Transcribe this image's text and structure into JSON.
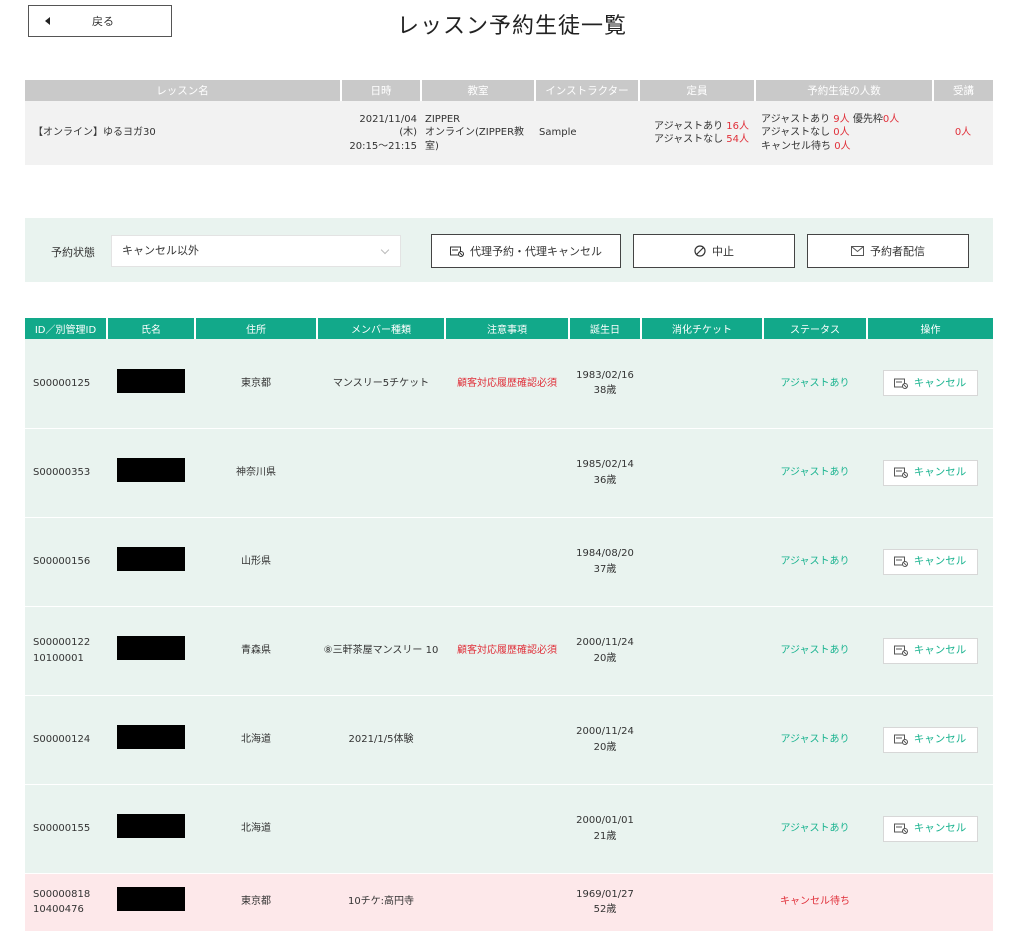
{
  "header": {
    "back_label": "戻る",
    "title": "レッスン予約生徒一覧"
  },
  "lesson": {
    "columns": [
      "レッスン名",
      "日時",
      "教室",
      "インストラクター",
      "定員",
      "予約生徒の人数",
      "受講"
    ],
    "name": "【オンライン】ゆるヨガ30",
    "date_line1": "2021/11/04 (木)",
    "date_line2": "20:15～21:15",
    "room_line1": "ZIPPER",
    "room_line2": "オンライン(ZIPPER教",
    "room_line3": "室)",
    "instructor": "Sample",
    "capacity": {
      "adjust_label": "アジャストあり",
      "adjust_value": "16人",
      "noadjust_label": "アジャストなし",
      "noadjust_value": "54人"
    },
    "reserved": {
      "adjust_label": "アジャストあり",
      "adjust_value": "9人",
      "priority_label": "優先枠",
      "priority_value": "0人",
      "noadjust_label": "アジャストなし",
      "noadjust_value": "0人",
      "wait_label": "キャンセル待ち",
      "wait_value": "0人"
    },
    "attended": "0人"
  },
  "filter": {
    "label": "予約状態",
    "selected": "キャンセル以外",
    "proxy_button": "代理予約・代理キャンセル",
    "stop_button": "中止",
    "mail_button": "予約者配信"
  },
  "table": {
    "columns": [
      "ID／別管理ID",
      "氏名",
      "住所",
      "メンバー種類",
      "注意事項",
      "誕生日",
      "消化チケット",
      "ステータス",
      "操作"
    ],
    "cancel_label": "キャンセル",
    "rows": [
      {
        "id": "S00000125",
        "sub_id": "",
        "address": "東京都",
        "member": "マンスリー5チケット",
        "note": "顧客対応履歴確認必須",
        "birth": "1983/02/16",
        "age": "38歳",
        "ticket": "",
        "status": "アジャストあり"
      },
      {
        "id": "S00000353",
        "sub_id": "",
        "address": "神奈川県",
        "member": "",
        "note": "",
        "birth": "1985/02/14",
        "age": "36歳",
        "ticket": "",
        "status": "アジャストあり"
      },
      {
        "id": "S00000156",
        "sub_id": "",
        "address": "山形県",
        "member": "",
        "note": "",
        "birth": "1984/08/20",
        "age": "37歳",
        "ticket": "",
        "status": "アジャストあり"
      },
      {
        "id": "S00000122",
        "sub_id": "10100001",
        "address": "青森県",
        "member": "⑧三軒茶屋マンスリー 10",
        "note": "顧客対応履歴確認必須",
        "birth": "2000/11/24",
        "age": "20歳",
        "ticket": "",
        "status": "アジャストあり"
      },
      {
        "id": "S00000124",
        "sub_id": "",
        "address": "北海道",
        "member": "2021/1/5体験",
        "note": "",
        "birth": "2000/11/24",
        "age": "20歳",
        "ticket": "",
        "status": "アジャストあり"
      },
      {
        "id": "S00000155",
        "sub_id": "",
        "address": "北海道",
        "member": "",
        "note": "",
        "birth": "2000/01/01",
        "age": "21歳",
        "ticket": "",
        "status": "アジャストあり"
      }
    ],
    "wait_row": {
      "id": "S00000818",
      "sub_id": "10400476",
      "address": "東京都",
      "member": "10チケ:高円寺",
      "note": "",
      "birth": "1969/01/27",
      "age": "52歳",
      "ticket": "",
      "status": "キャンセル待ち"
    }
  },
  "colors": {
    "accent": "#12a98a",
    "status_green": "#19b38f",
    "warn_red": "#e0303a",
    "row_bg": "#e9f3ef",
    "wait_bg": "#fde8ea"
  }
}
